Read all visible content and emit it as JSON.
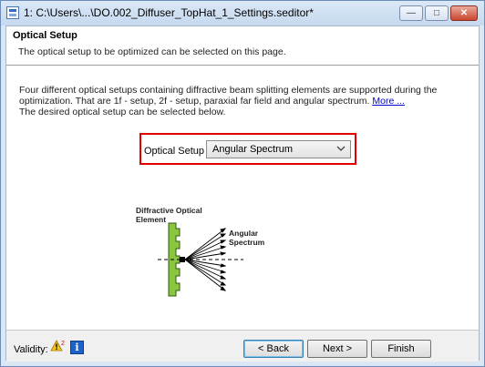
{
  "window": {
    "title": "1: C:\\Users\\...\\DO.002_Diffuser_TopHat_1_Settings.seditor*",
    "controls": {
      "minimize": "—",
      "maximize": "□",
      "close": "✕"
    }
  },
  "header": {
    "title": "Optical Setup",
    "subtitle": "The optical setup to be optimized can be selected on this page."
  },
  "description": {
    "line1": "Four different optical setups containing diffractive beam splitting elements are supported during the",
    "line2": "optimization. That are 1f - setup, 2f - setup, paraxial far field and angular spectrum.",
    "more_link": "More ...",
    "line3": "The desired optical setup can be selected below."
  },
  "optical_setup": {
    "label": "Optical Setup",
    "selected": "Angular Spectrum"
  },
  "diagram": {
    "element_label_1": "Diffractive Optical",
    "element_label_2": "Element",
    "output_label_1": "Angular",
    "output_label_2": "Spectrum"
  },
  "footer": {
    "validity_label": "Validity:",
    "warning_count": "2",
    "info_glyph": "i",
    "back_label": "< Back",
    "next_label": "Next >",
    "finish_label": "Finish"
  },
  "colors": {
    "highlight": "#e00000",
    "doe_green": "#8cc63e",
    "info_blue": "#1b63c6",
    "link": "#0000cc"
  }
}
